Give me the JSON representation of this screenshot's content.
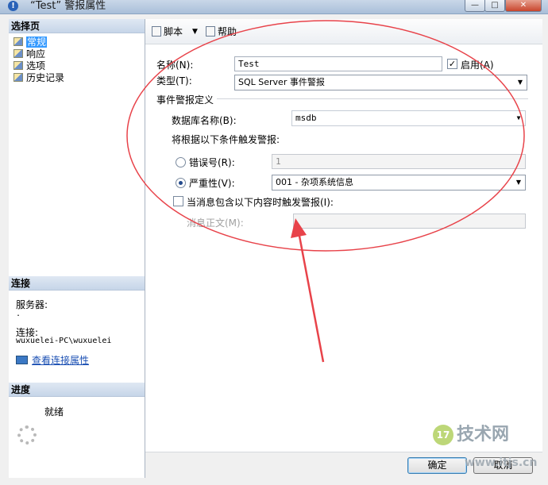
{
  "window": {
    "title": "“Test” 警报属性",
    "controls": {
      "minimize": "—",
      "maximize": "□",
      "close": "✕"
    }
  },
  "left": {
    "select_page_header": "选择页",
    "pages": [
      {
        "label": "常规",
        "selected": true
      },
      {
        "label": "响应",
        "selected": false
      },
      {
        "label": "选项",
        "selected": false
      },
      {
        "label": "历史记录",
        "selected": false
      }
    ],
    "connection_header": "连接",
    "server_label": "服务器:",
    "server_value": ".",
    "connection_label": "连接:",
    "connection_value": "wuxuelei-PC\\wuxuelei",
    "view_conn_link": "查看连接属性",
    "progress_header": "进度",
    "progress_status": "就绪"
  },
  "toolbar": {
    "script_label": "脚本",
    "script_arrow": "▼",
    "help_label": "帮助"
  },
  "form": {
    "name_label": "名称(N):",
    "name_value": "Test",
    "enable_label": "启用(A)",
    "enable_checked": "✓",
    "type_label": "类型(T):",
    "type_value": "SQL Server 事件警报",
    "event_def_label": "事件警报定义",
    "db_label": "数据库名称(B):",
    "db_value": "msdb",
    "trigger_label": "将根据以下条件触发警报:",
    "error_label": "错误号(R):",
    "error_value": "1",
    "severity_label": "严重性(V):",
    "severity_value": "001 - 杂项系统信息",
    "msg_contains_label": "当消息包含以下内容时触发警报(I):",
    "msg_text_label": "消息正文(M):",
    "msg_text_value": ""
  },
  "buttons": {
    "ok": "确定",
    "cancel": "取消"
  },
  "watermark": {
    "logo": "17",
    "text": "技术网",
    "url": "www.itjs.cn"
  },
  "colors": {
    "annotation": "#e8434a",
    "selection": "#3399ff"
  }
}
